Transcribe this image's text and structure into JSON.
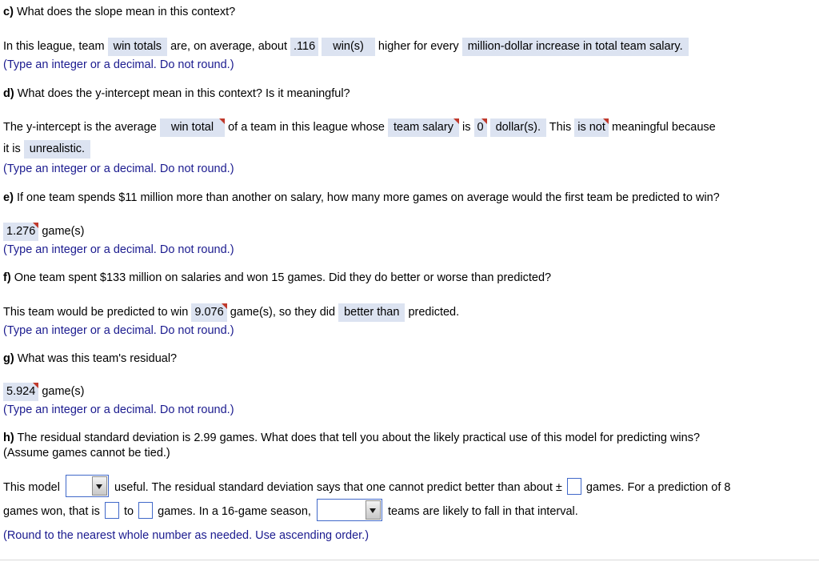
{
  "colors": {
    "answer_highlight": "#dce3f1",
    "hint_text": "#1b1b8f",
    "input_border": "#4169c9",
    "flag_marker": "#c0392b"
  },
  "questions": {
    "c": {
      "label": "c)",
      "prompt": "What does the slope mean in this context?",
      "sentence": {
        "part1": "In this league, team",
        "answer1": "win totals",
        "part2": "are, on average, about",
        "answer2": ".116",
        "answer3": "win(s)",
        "part3": "higher for every",
        "answer4": "million-dollar increase in total team salary."
      },
      "hint": "(Type an integer or a decimal. Do not round.)"
    },
    "d": {
      "label": "d)",
      "prompt": "What does the y-intercept mean in this context? Is it meaningful?",
      "sentence": {
        "part1": "The y-intercept is the average",
        "answer1": "win total",
        "part2": "of a team in this league whose",
        "answer2": "team salary",
        "part3": "is",
        "answer3": "0",
        "answer4": "dollar(s).",
        "part4": "This",
        "answer5": "is not",
        "part5": "meaningful because",
        "part6": "it is",
        "answer6": "unrealistic."
      },
      "hint": "(Type an integer or a decimal. Do not round.)"
    },
    "e": {
      "label": "e)",
      "prompt": "If one team spends $11 million more than another on salary, how many more games on average would the first team be predicted to win?",
      "answer": "1.276",
      "unit": "game(s)",
      "hint": "(Type an integer or a decimal. Do not round.)"
    },
    "f": {
      "label": "f)",
      "prompt": "One team spent $133 million on salaries and won 15 games. Did they do better or worse than predicted?",
      "sentence": {
        "part1": "This team would be predicted to win",
        "answer1": "9.076",
        "part2": "game(s), so they did",
        "answer2": "better than",
        "part3": "predicted."
      },
      "hint": "(Type an integer or a decimal. Do not round.)"
    },
    "g": {
      "label": "g)",
      "prompt": "What was this team's residual?",
      "answer": "5.924",
      "unit": "game(s)",
      "hint": "(Type an integer or a decimal. Do not round.)"
    },
    "h": {
      "label": "h)",
      "prompt_line1": "The residual standard deviation is 2.99 games. What does that tell you about the likely practical use of this model for predicting wins?",
      "prompt_line2": "(Assume games cannot be tied.)",
      "sentence": {
        "part1": "This model",
        "select1_value": "",
        "part2": "useful. The residual standard deviation says that one cannot predict better than about ±",
        "input1_value": "",
        "part3": "games. For a prediction of 8",
        "part4": "games won, that is",
        "input2_value": "",
        "part5": "to",
        "input3_value": "",
        "part6": "games. In a 16-game season,",
        "select2_value": "",
        "part7": "teams are likely to fall in that interval."
      },
      "hint": "(Round to the nearest whole number as needed. Use ascending order.)"
    }
  }
}
